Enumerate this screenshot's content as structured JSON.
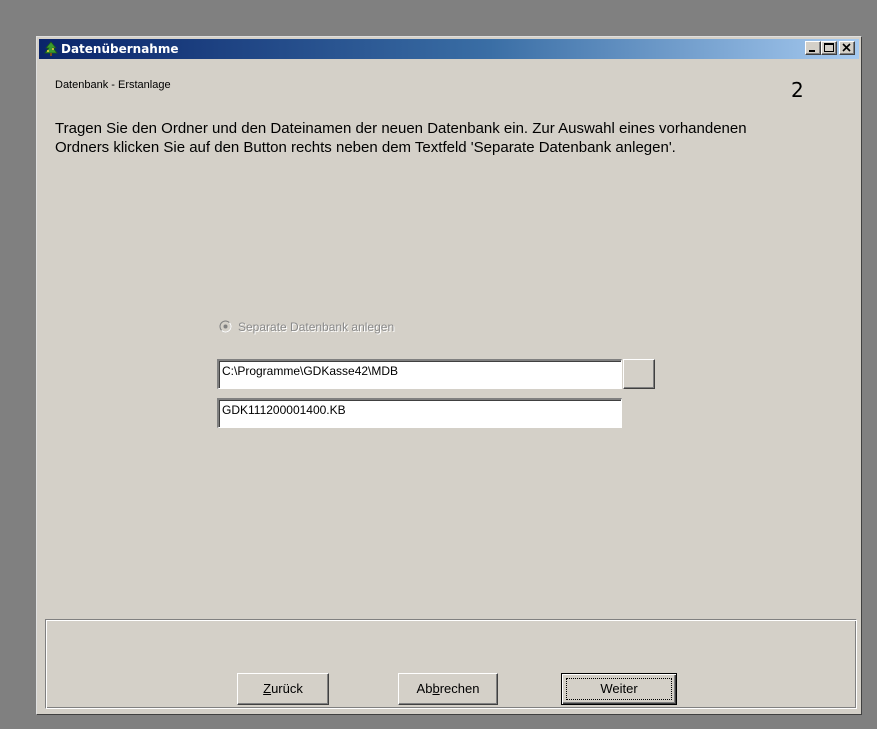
{
  "window": {
    "title": "Datenübernahme",
    "icon": "app-tree-icon"
  },
  "titlebar_buttons": {
    "minimize_icon": "minimize-icon",
    "maximize_icon": "maximize-icon",
    "close_icon": "close-icon"
  },
  "header": {
    "subtitle": "Datenbank - Erstanlage",
    "step": "2"
  },
  "instructions": {
    "text": "Tragen Sie den Ordner und den Dateinamen der neuen Datenbank ein. Zur Auswahl eines vorhandenen Ordners klicken Sie auf den Button rechts neben dem Textfeld 'Separate Datenbank anlegen'."
  },
  "form": {
    "radio_label": "Separate Datenbank anlegen",
    "radio_selected": true,
    "radio_enabled": false,
    "path_value": "C:\\Programme\\GDKasse42\\MDB",
    "filename_value": "GDK111200001400.KB",
    "browse_label": ""
  },
  "buttons": {
    "back": {
      "before": "",
      "mnemonic": "Z",
      "after": "urück"
    },
    "cancel": {
      "before": "Ab",
      "mnemonic": "b",
      "after": "rechen"
    },
    "next": {
      "label": "Weiter"
    }
  },
  "colors": {
    "title_gradient_start": "#0a246a",
    "title_gradient_end": "#a6caf0",
    "window_face": "#d4d0c8",
    "desktop": "#808080"
  }
}
